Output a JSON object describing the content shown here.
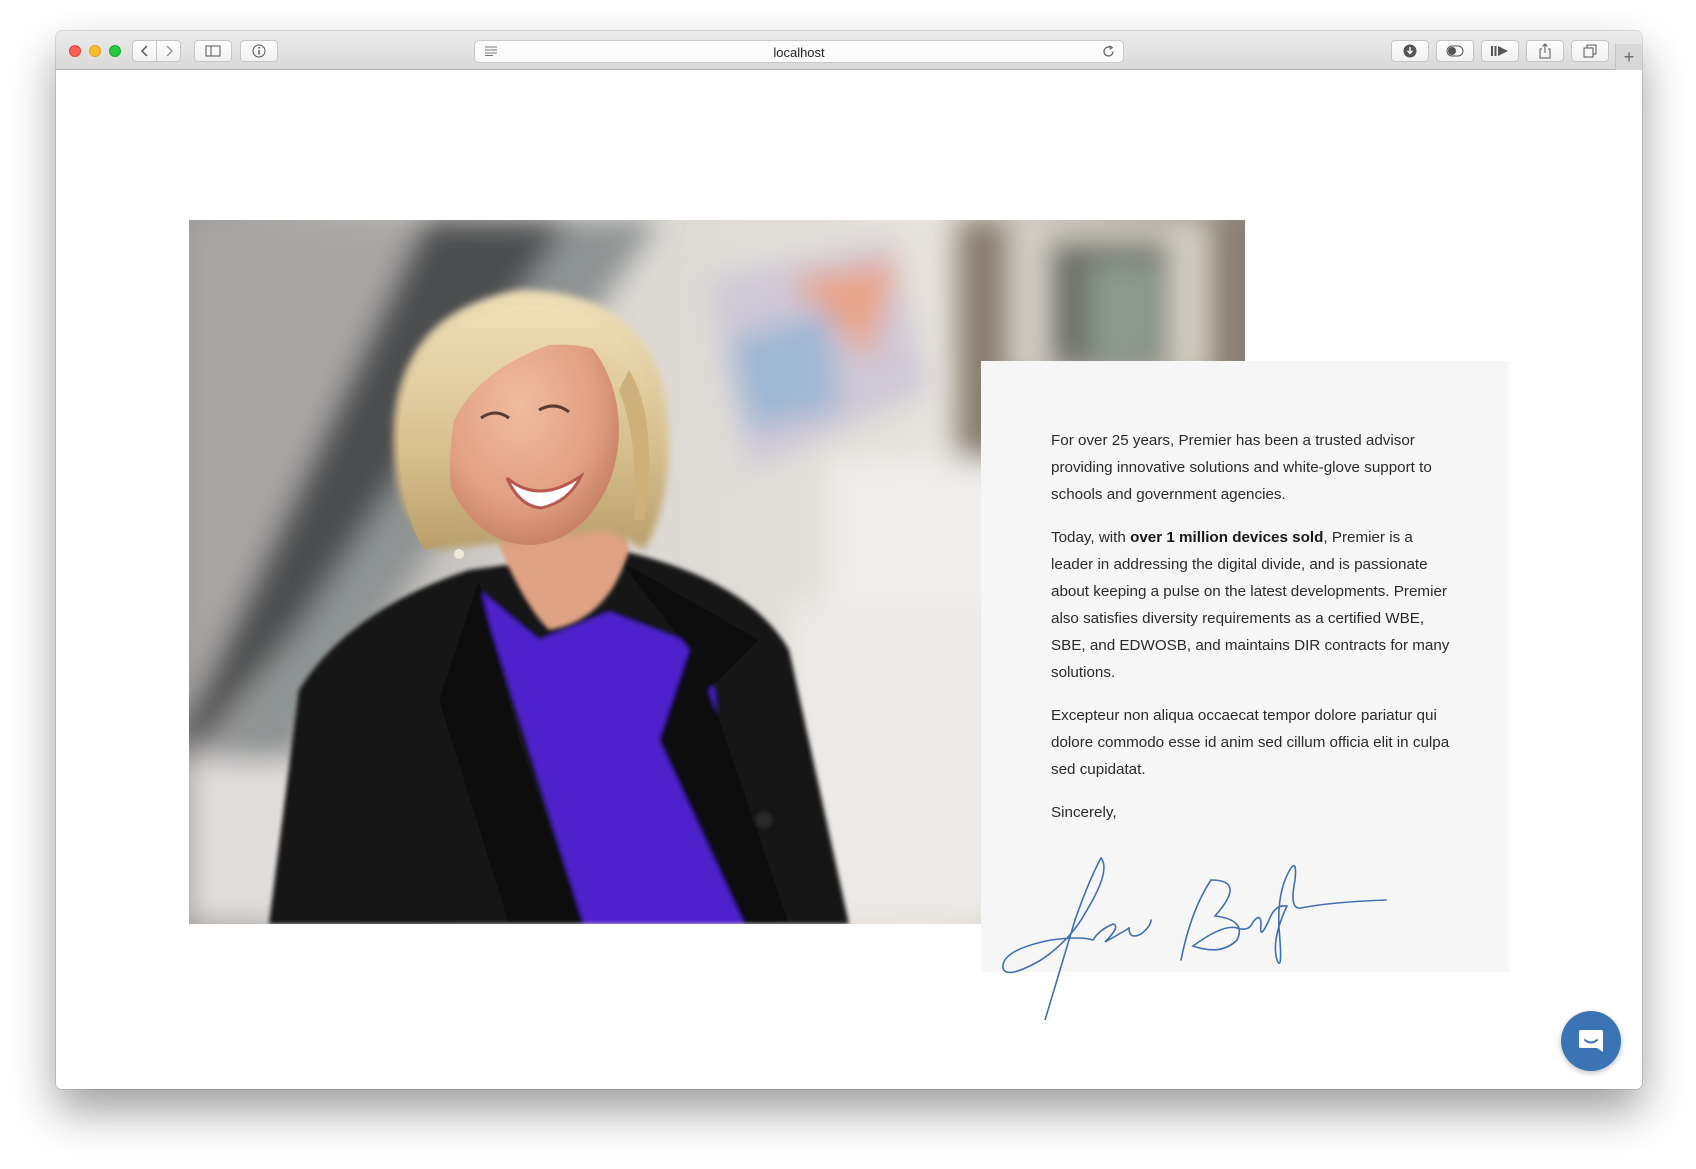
{
  "browser": {
    "url": "localhost",
    "new_tab_label": "+",
    "icons": {
      "back": "chevron-left-icon",
      "forward": "chevron-right-icon",
      "sidebar": "sidebar-icon",
      "info": "info-icon",
      "reader": "reader-lines-icon",
      "reload": "reload-icon",
      "download": "download-icon",
      "toggle": "toggle-icon",
      "airplay": "media-icon",
      "share": "share-icon",
      "tabs": "tabs-icon"
    }
  },
  "letter": {
    "p1": "For over 25 years, Premier has been a trusted advisor providing innovative solutions and white-glove support to schools and government agencies.",
    "p2_prefix": "Today, with ",
    "p2_bold": "over 1 million devices sold",
    "p2_suffix": ", Premier is a leader in addressing the digital divide, and is passionate about keeping a pulse on the latest developments. Premier also satisfies diversity requirements as a certified WBE, SBE, and EDWOSB, and maintains DIR contracts for many solutions.",
    "p3": "Excepteur non aliqua occaecat tempor dolore pariatur qui dolore commodo esse id anim sed cillum officia elit in culpa sed cupidatat.",
    "closing": "Sincerely,",
    "signature_text": "Lea Boyle"
  },
  "colors": {
    "signature_ink": "#3f6fb0",
    "chat_button": "#3a74b4",
    "letter_bg": "#f6f6f6"
  },
  "chat": {
    "icon": "chat-bubble-icon"
  }
}
